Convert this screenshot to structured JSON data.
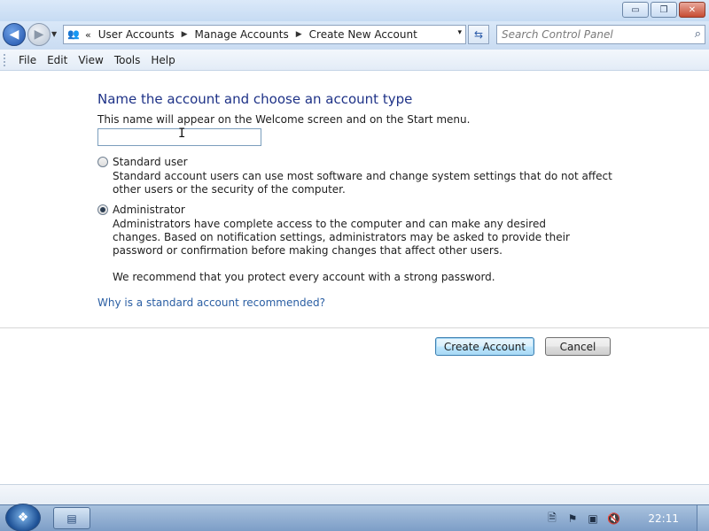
{
  "window": {
    "minimize_label": "▭",
    "maximize_label": "❐",
    "close_label": "✕"
  },
  "address": {
    "chevron": "«",
    "breadcrumbs": [
      "User Accounts",
      "Manage Accounts",
      "Create New Account"
    ],
    "separator": "▶",
    "dropdown": "▾",
    "refresh": "⇆"
  },
  "search": {
    "placeholder": "Search Control Panel",
    "icon": "⌕"
  },
  "menu": {
    "items": [
      "File",
      "Edit",
      "View",
      "Tools",
      "Help"
    ]
  },
  "form": {
    "heading": "Name the account and choose an account type",
    "subtext": "This name will appear on the Welcome screen and on the Start menu.",
    "name_value": "",
    "options": [
      {
        "label": "Standard user",
        "selected": false,
        "description": "Standard account users can use most software and change system settings that do not affect other users or the security of the computer."
      },
      {
        "label": "Administrator",
        "selected": true,
        "description": "Administrators have complete access to the computer and can make any desired changes. Based on notification settings, administrators may be asked to provide their password or confirmation before making changes that affect other users."
      }
    ],
    "recommendation": "We recommend that you protect every account with a strong password.",
    "help_link": "Why is a standard account recommended?",
    "create_button": "Create Account",
    "cancel_button": "Cancel"
  },
  "taskbar": {
    "clock": "22:11",
    "tray_icons": [
      "document-icon",
      "flag-icon",
      "network-error-icon",
      "speaker-muted-icon"
    ]
  }
}
